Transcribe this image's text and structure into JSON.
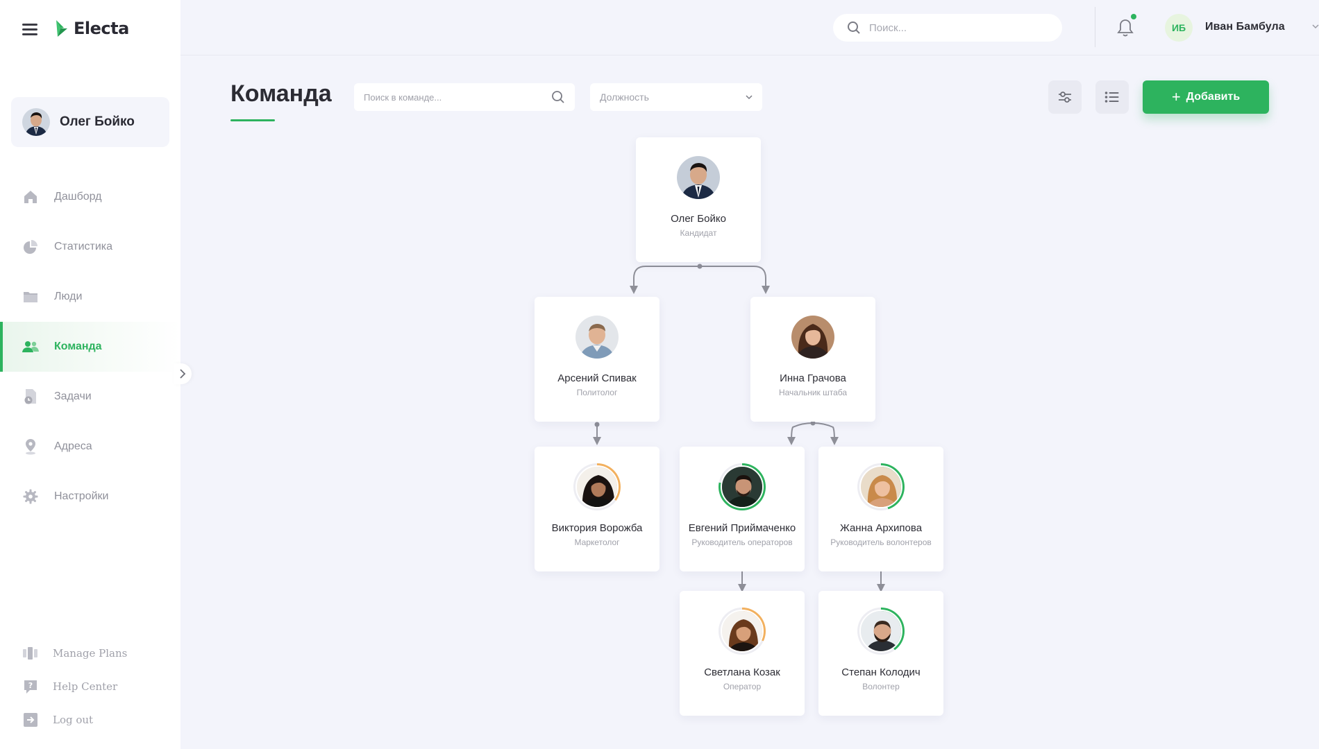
{
  "app": {
    "name": "Electa"
  },
  "sidebar": {
    "profile_name": "Олег Бойко",
    "items": [
      {
        "label": "Дашборд",
        "icon": "home-icon"
      },
      {
        "label": "Статистика",
        "icon": "pie-chart-icon"
      },
      {
        "label": "Люди",
        "icon": "folder-icon"
      },
      {
        "label": "Команда",
        "icon": "team-icon",
        "active": true
      },
      {
        "label": "Задачи",
        "icon": "tasks-icon"
      },
      {
        "label": "Адреса",
        "icon": "map-pin-icon"
      },
      {
        "label": "Настройки",
        "icon": "gear-icon"
      }
    ],
    "bottom": [
      {
        "label": "Manage Plans",
        "icon": "plans-icon"
      },
      {
        "label": "Help Center",
        "icon": "help-icon"
      },
      {
        "label": "Log out",
        "icon": "logout-icon"
      }
    ]
  },
  "header": {
    "search_placeholder": "Поиск...",
    "user_initials": "ИБ",
    "user_name": "Иван Бамбула"
  },
  "toolbar": {
    "title": "Команда",
    "team_search_placeholder": "Поиск в команде...",
    "position_select": "Должность",
    "add_label": "Добавить"
  },
  "colors": {
    "accent": "#2db35e",
    "progress_orange": "#f2b05e",
    "text_muted": "#a0a1aa"
  },
  "team": {
    "root": {
      "name": "Олег Бойко",
      "role": "Кандидат"
    },
    "spivak": {
      "name": "Арсений Спивак",
      "role": "Политолог"
    },
    "gracheva": {
      "name": "Инна Грачова",
      "role": "Начальник штаба"
    },
    "vorozhba": {
      "name": "Виктория Ворожба",
      "role": "Маркетолог"
    },
    "pryimachenko": {
      "name": "Евгений Приймаченко",
      "role": "Руководитель операторов"
    },
    "arkhipova": {
      "name": "Жанна Архипова",
      "role": "Руководитель волонтеров"
    },
    "kozak": {
      "name": "Светлана Козак",
      "role": "Оператор"
    },
    "kolodych": {
      "name": "Степан Колодич",
      "role": "Волонтер"
    }
  }
}
